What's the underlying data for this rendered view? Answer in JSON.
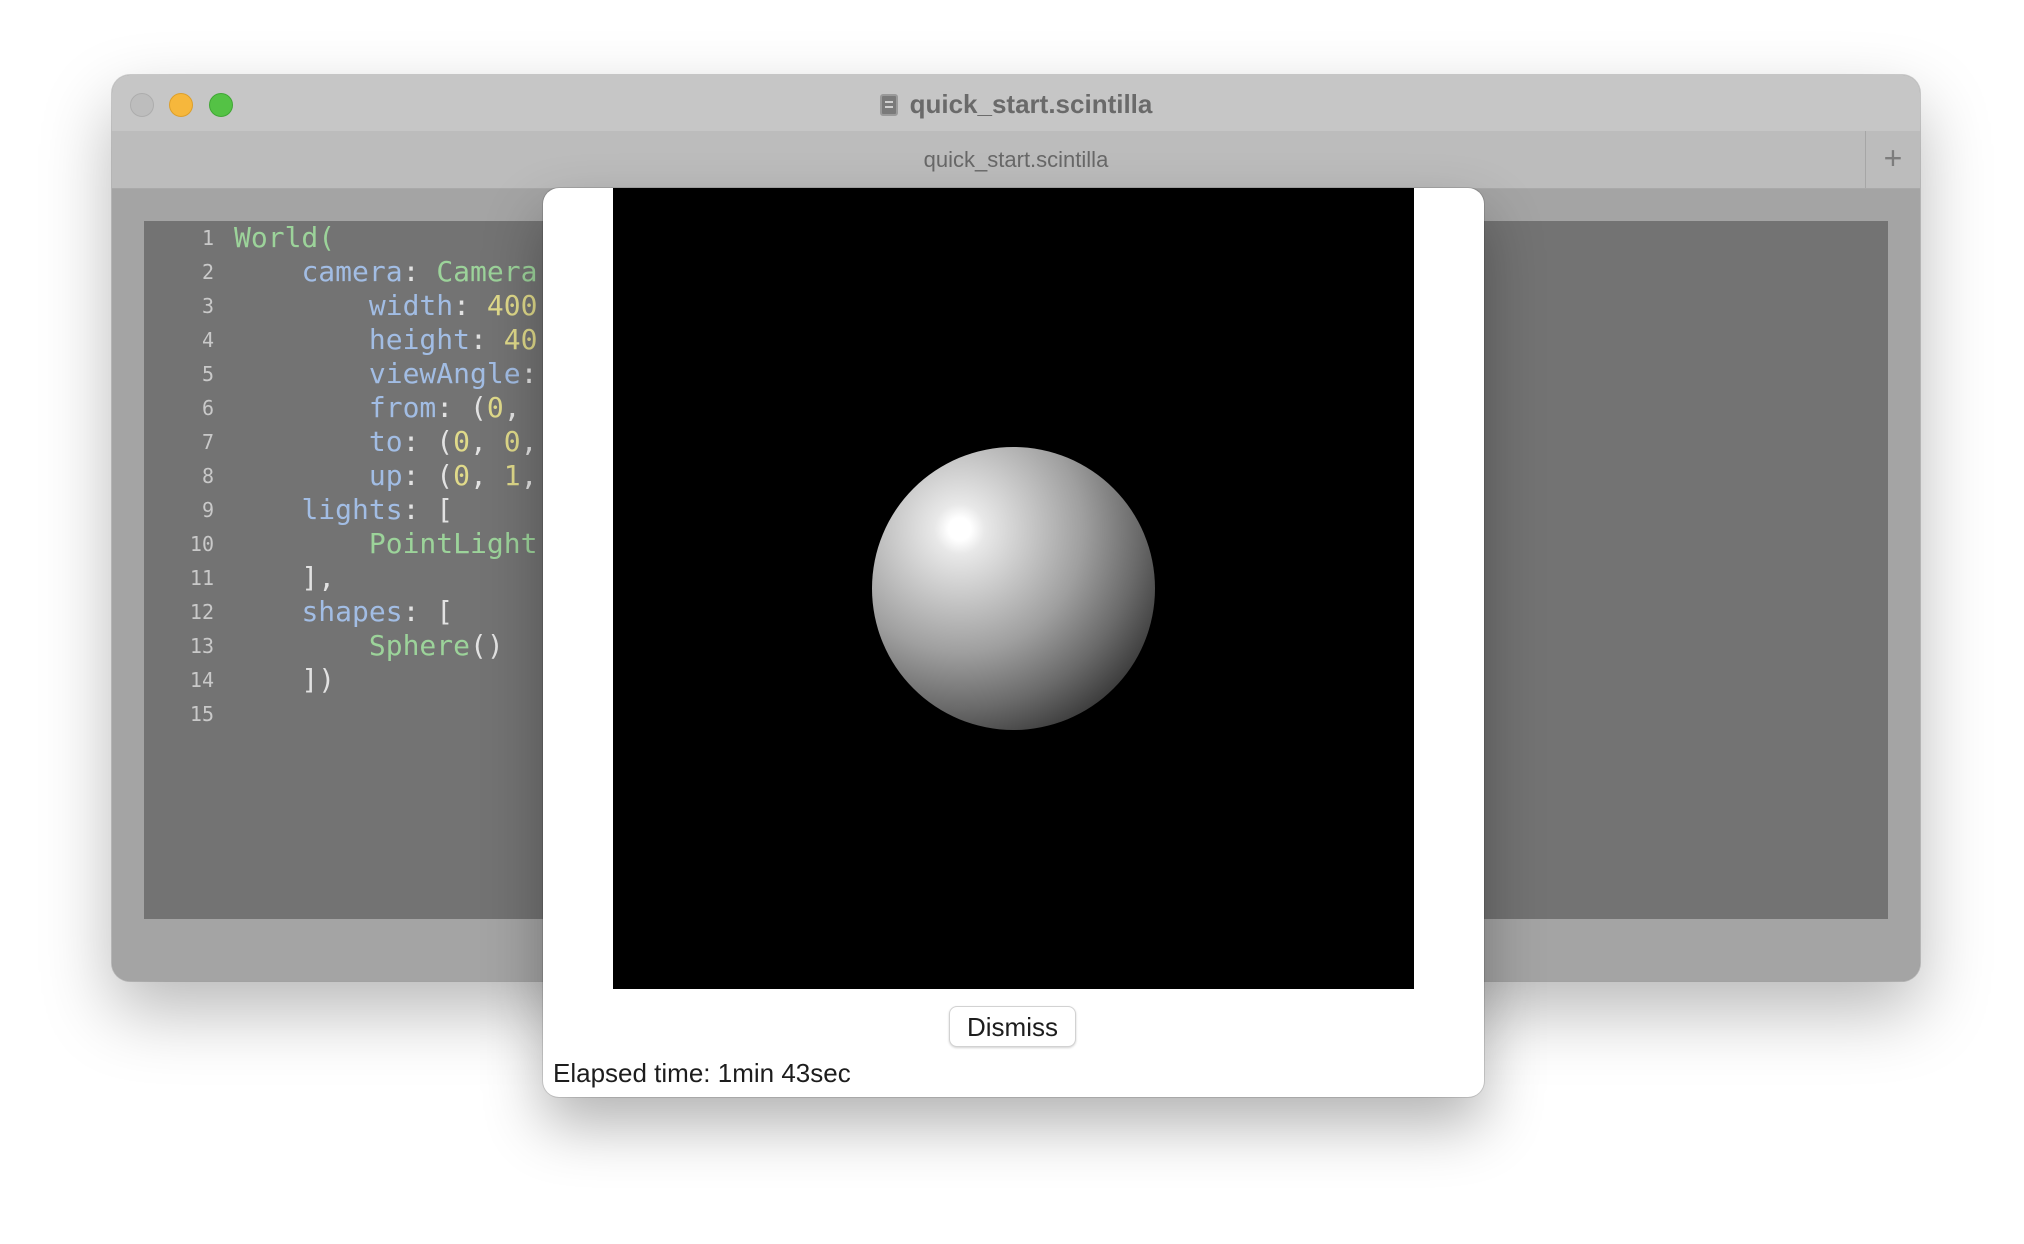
{
  "window": {
    "title": "quick_start.scintilla",
    "tab_label": "quick_start.scintilla",
    "new_tab_label": "+"
  },
  "editor": {
    "lines": [
      {
        "num": "1",
        "tokens": [
          {
            "t": "World(",
            "k": "type"
          }
        ]
      },
      {
        "num": "2",
        "tokens": [
          {
            "t": "    ",
            "k": "punc"
          },
          {
            "t": "camera",
            "k": "prop"
          },
          {
            "t": ": ",
            "k": "punc"
          },
          {
            "t": "Camera",
            "k": "type"
          }
        ]
      },
      {
        "num": "3",
        "tokens": [
          {
            "t": "        ",
            "k": "punc"
          },
          {
            "t": "width",
            "k": "prop"
          },
          {
            "t": ": ",
            "k": "punc"
          },
          {
            "t": "400",
            "k": "num"
          }
        ]
      },
      {
        "num": "4",
        "tokens": [
          {
            "t": "        ",
            "k": "punc"
          },
          {
            "t": "height",
            "k": "prop"
          },
          {
            "t": ": ",
            "k": "punc"
          },
          {
            "t": "40",
            "k": "num"
          }
        ]
      },
      {
        "num": "5",
        "tokens": [
          {
            "t": "        ",
            "k": "punc"
          },
          {
            "t": "viewAngle",
            "k": "prop"
          },
          {
            "t": ":",
            "k": "punc"
          }
        ]
      },
      {
        "num": "6",
        "tokens": [
          {
            "t": "        ",
            "k": "punc"
          },
          {
            "t": "from",
            "k": "prop"
          },
          {
            "t": ": (",
            "k": "punc"
          },
          {
            "t": "0",
            "k": "num"
          },
          {
            "t": ",",
            "k": "punc"
          }
        ]
      },
      {
        "num": "7",
        "tokens": [
          {
            "t": "        ",
            "k": "punc"
          },
          {
            "t": "to",
            "k": "prop"
          },
          {
            "t": ": (",
            "k": "punc"
          },
          {
            "t": "0",
            "k": "num"
          },
          {
            "t": ", ",
            "k": "punc"
          },
          {
            "t": "0",
            "k": "num"
          },
          {
            "t": ",",
            "k": "punc"
          }
        ]
      },
      {
        "num": "8",
        "tokens": [
          {
            "t": "        ",
            "k": "punc"
          },
          {
            "t": "up",
            "k": "prop"
          },
          {
            "t": ": (",
            "k": "punc"
          },
          {
            "t": "0",
            "k": "num"
          },
          {
            "t": ", ",
            "k": "punc"
          },
          {
            "t": "1",
            "k": "num"
          },
          {
            "t": ",",
            "k": "punc"
          }
        ]
      },
      {
        "num": "9",
        "tokens": [
          {
            "t": "    ",
            "k": "punc"
          },
          {
            "t": "lights",
            "k": "prop"
          },
          {
            "t": ": [",
            "k": "punc"
          }
        ]
      },
      {
        "num": "10",
        "tokens": [
          {
            "t": "        ",
            "k": "punc"
          },
          {
            "t": "PointLight",
            "k": "type"
          }
        ]
      },
      {
        "num": "11",
        "tokens": [
          {
            "t": "    ],",
            "k": "punc"
          }
        ]
      },
      {
        "num": "12",
        "tokens": [
          {
            "t": "    ",
            "k": "punc"
          },
          {
            "t": "shapes",
            "k": "prop"
          },
          {
            "t": ": [",
            "k": "punc"
          }
        ]
      },
      {
        "num": "13",
        "tokens": [
          {
            "t": "        ",
            "k": "punc"
          },
          {
            "t": "Sphere",
            "k": "type"
          },
          {
            "t": "()",
            "k": "punc"
          }
        ]
      },
      {
        "num": "14",
        "tokens": [
          {
            "t": "    ])",
            "k": "punc"
          }
        ]
      },
      {
        "num": "15",
        "tokens": []
      }
    ]
  },
  "dialog": {
    "dismiss_label": "Dismiss",
    "elapsed_text": "Elapsed time: 1min 43sec"
  },
  "colors": {
    "syntax_type": "#9cd39a",
    "syntax_property": "#a2bde4",
    "syntax_number": "#e0da8a",
    "syntax_punctuation": "#e2e2e2",
    "editor_background": "#737373",
    "render_background": "#000000",
    "traffic_close": "#bdbdbd",
    "traffic_minimize": "#f6b73c",
    "traffic_maximize": "#54c245"
  },
  "icons": {
    "title_document": "document-icon",
    "new_tab": "plus-icon"
  }
}
